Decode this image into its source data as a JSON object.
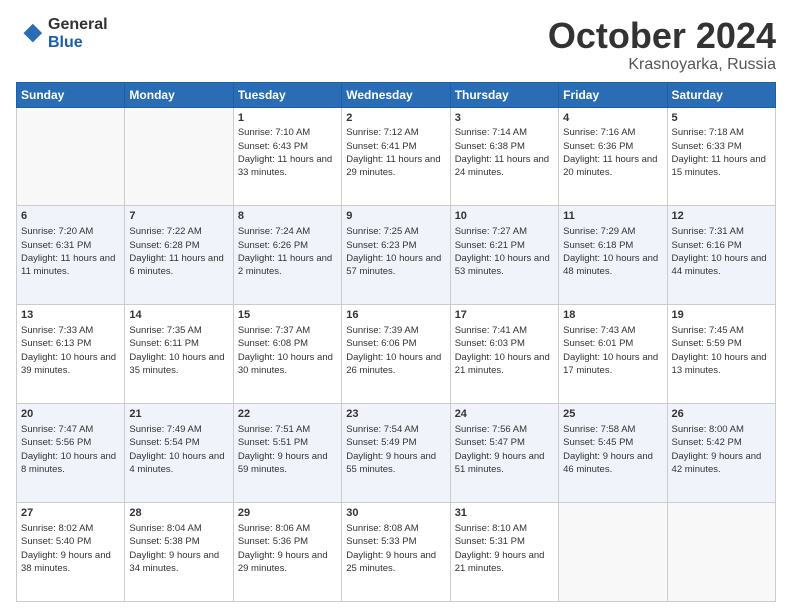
{
  "logo": {
    "general": "General",
    "blue": "Blue"
  },
  "title": {
    "month": "October 2024",
    "location": "Krasnoyarka, Russia"
  },
  "days_header": [
    "Sunday",
    "Monday",
    "Tuesday",
    "Wednesday",
    "Thursday",
    "Friday",
    "Saturday"
  ],
  "weeks": [
    [
      {
        "num": "",
        "sunrise": "",
        "sunset": "",
        "daylight": ""
      },
      {
        "num": "",
        "sunrise": "",
        "sunset": "",
        "daylight": ""
      },
      {
        "num": "1",
        "sunrise": "Sunrise: 7:10 AM",
        "sunset": "Sunset: 6:43 PM",
        "daylight": "Daylight: 11 hours and 33 minutes."
      },
      {
        "num": "2",
        "sunrise": "Sunrise: 7:12 AM",
        "sunset": "Sunset: 6:41 PM",
        "daylight": "Daylight: 11 hours and 29 minutes."
      },
      {
        "num": "3",
        "sunrise": "Sunrise: 7:14 AM",
        "sunset": "Sunset: 6:38 PM",
        "daylight": "Daylight: 11 hours and 24 minutes."
      },
      {
        "num": "4",
        "sunrise": "Sunrise: 7:16 AM",
        "sunset": "Sunset: 6:36 PM",
        "daylight": "Daylight: 11 hours and 20 minutes."
      },
      {
        "num": "5",
        "sunrise": "Sunrise: 7:18 AM",
        "sunset": "Sunset: 6:33 PM",
        "daylight": "Daylight: 11 hours and 15 minutes."
      }
    ],
    [
      {
        "num": "6",
        "sunrise": "Sunrise: 7:20 AM",
        "sunset": "Sunset: 6:31 PM",
        "daylight": "Daylight: 11 hours and 11 minutes."
      },
      {
        "num": "7",
        "sunrise": "Sunrise: 7:22 AM",
        "sunset": "Sunset: 6:28 PM",
        "daylight": "Daylight: 11 hours and 6 minutes."
      },
      {
        "num": "8",
        "sunrise": "Sunrise: 7:24 AM",
        "sunset": "Sunset: 6:26 PM",
        "daylight": "Daylight: 11 hours and 2 minutes."
      },
      {
        "num": "9",
        "sunrise": "Sunrise: 7:25 AM",
        "sunset": "Sunset: 6:23 PM",
        "daylight": "Daylight: 10 hours and 57 minutes."
      },
      {
        "num": "10",
        "sunrise": "Sunrise: 7:27 AM",
        "sunset": "Sunset: 6:21 PM",
        "daylight": "Daylight: 10 hours and 53 minutes."
      },
      {
        "num": "11",
        "sunrise": "Sunrise: 7:29 AM",
        "sunset": "Sunset: 6:18 PM",
        "daylight": "Daylight: 10 hours and 48 minutes."
      },
      {
        "num": "12",
        "sunrise": "Sunrise: 7:31 AM",
        "sunset": "Sunset: 6:16 PM",
        "daylight": "Daylight: 10 hours and 44 minutes."
      }
    ],
    [
      {
        "num": "13",
        "sunrise": "Sunrise: 7:33 AM",
        "sunset": "Sunset: 6:13 PM",
        "daylight": "Daylight: 10 hours and 39 minutes."
      },
      {
        "num": "14",
        "sunrise": "Sunrise: 7:35 AM",
        "sunset": "Sunset: 6:11 PM",
        "daylight": "Daylight: 10 hours and 35 minutes."
      },
      {
        "num": "15",
        "sunrise": "Sunrise: 7:37 AM",
        "sunset": "Sunset: 6:08 PM",
        "daylight": "Daylight: 10 hours and 30 minutes."
      },
      {
        "num": "16",
        "sunrise": "Sunrise: 7:39 AM",
        "sunset": "Sunset: 6:06 PM",
        "daylight": "Daylight: 10 hours and 26 minutes."
      },
      {
        "num": "17",
        "sunrise": "Sunrise: 7:41 AM",
        "sunset": "Sunset: 6:03 PM",
        "daylight": "Daylight: 10 hours and 21 minutes."
      },
      {
        "num": "18",
        "sunrise": "Sunrise: 7:43 AM",
        "sunset": "Sunset: 6:01 PM",
        "daylight": "Daylight: 10 hours and 17 minutes."
      },
      {
        "num": "19",
        "sunrise": "Sunrise: 7:45 AM",
        "sunset": "Sunset: 5:59 PM",
        "daylight": "Daylight: 10 hours and 13 minutes."
      }
    ],
    [
      {
        "num": "20",
        "sunrise": "Sunrise: 7:47 AM",
        "sunset": "Sunset: 5:56 PM",
        "daylight": "Daylight: 10 hours and 8 minutes."
      },
      {
        "num": "21",
        "sunrise": "Sunrise: 7:49 AM",
        "sunset": "Sunset: 5:54 PM",
        "daylight": "Daylight: 10 hours and 4 minutes."
      },
      {
        "num": "22",
        "sunrise": "Sunrise: 7:51 AM",
        "sunset": "Sunset: 5:51 PM",
        "daylight": "Daylight: 9 hours and 59 minutes."
      },
      {
        "num": "23",
        "sunrise": "Sunrise: 7:54 AM",
        "sunset": "Sunset: 5:49 PM",
        "daylight": "Daylight: 9 hours and 55 minutes."
      },
      {
        "num": "24",
        "sunrise": "Sunrise: 7:56 AM",
        "sunset": "Sunset: 5:47 PM",
        "daylight": "Daylight: 9 hours and 51 minutes."
      },
      {
        "num": "25",
        "sunrise": "Sunrise: 7:58 AM",
        "sunset": "Sunset: 5:45 PM",
        "daylight": "Daylight: 9 hours and 46 minutes."
      },
      {
        "num": "26",
        "sunrise": "Sunrise: 8:00 AM",
        "sunset": "Sunset: 5:42 PM",
        "daylight": "Daylight: 9 hours and 42 minutes."
      }
    ],
    [
      {
        "num": "27",
        "sunrise": "Sunrise: 8:02 AM",
        "sunset": "Sunset: 5:40 PM",
        "daylight": "Daylight: 9 hours and 38 minutes."
      },
      {
        "num": "28",
        "sunrise": "Sunrise: 8:04 AM",
        "sunset": "Sunset: 5:38 PM",
        "daylight": "Daylight: 9 hours and 34 minutes."
      },
      {
        "num": "29",
        "sunrise": "Sunrise: 8:06 AM",
        "sunset": "Sunset: 5:36 PM",
        "daylight": "Daylight: 9 hours and 29 minutes."
      },
      {
        "num": "30",
        "sunrise": "Sunrise: 8:08 AM",
        "sunset": "Sunset: 5:33 PM",
        "daylight": "Daylight: 9 hours and 25 minutes."
      },
      {
        "num": "31",
        "sunrise": "Sunrise: 8:10 AM",
        "sunset": "Sunset: 5:31 PM",
        "daylight": "Daylight: 9 hours and 21 minutes."
      },
      {
        "num": "",
        "sunrise": "",
        "sunset": "",
        "daylight": ""
      },
      {
        "num": "",
        "sunrise": "",
        "sunset": "",
        "daylight": ""
      }
    ]
  ]
}
